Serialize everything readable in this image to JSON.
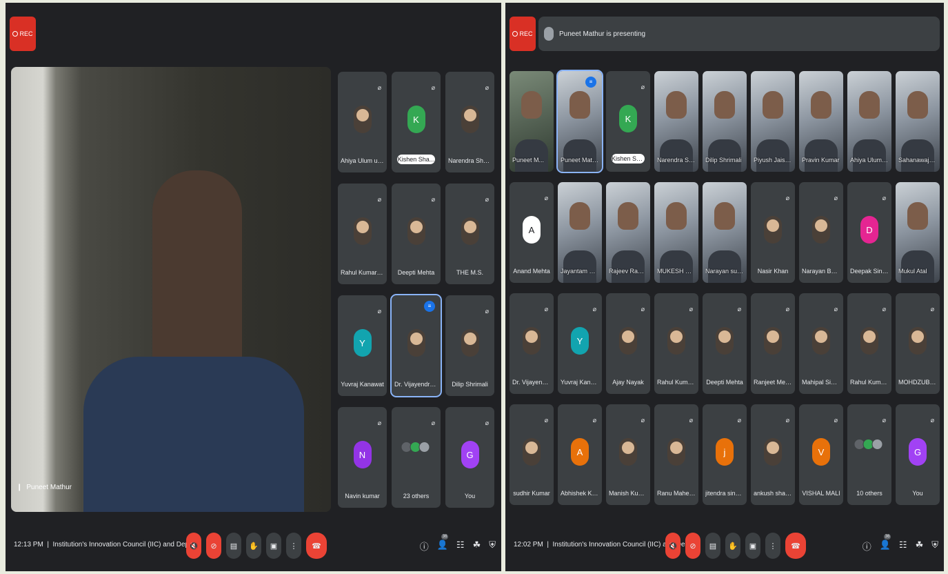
{
  "left": {
    "rec": "REC",
    "main_speaker": "Puneet Mathur",
    "tiles": [
      {
        "name": "Ahiya Ulum uddin",
        "type": "img"
      },
      {
        "name": "Kishen Sha...",
        "type": "letter",
        "letter": "K",
        "color": "#34a853",
        "pill": true
      },
      {
        "name": "Narendra Sharma",
        "type": "img"
      },
      {
        "name": "Rahul Kumar sen",
        "type": "img"
      },
      {
        "name": "Deepti Mehta",
        "type": "img"
      },
      {
        "name": "THE M.S.",
        "type": "img"
      },
      {
        "name": "Yuvraj Kanawat",
        "type": "letter",
        "letter": "Y",
        "color": "#12a4af"
      },
      {
        "name": "Dr. Vijayendra Si...",
        "type": "img",
        "speaking": true
      },
      {
        "name": "Dilip Shrimali",
        "type": "img"
      },
      {
        "name": "Navin kumar",
        "type": "letter",
        "letter": "N",
        "color": "#9334e6"
      },
      {
        "name": "23 others",
        "type": "others"
      },
      {
        "name": "You",
        "type": "letter",
        "letter": "G",
        "color": "#a142f4"
      }
    ],
    "time": "12:13 PM",
    "meeting": "Institution's Innovation Council (IIC) and Depa...",
    "people_count": "36"
  },
  "right": {
    "rec": "REC",
    "presenting": "Puneet Mathur is presenting",
    "tiles": [
      {
        "name": "Puneet M...",
        "type": "screen"
      },
      {
        "name": "Puneet Mathur",
        "type": "video",
        "speaking": true
      },
      {
        "name": "Kishen Sha...",
        "type": "letter",
        "letter": "K",
        "color": "#34a853",
        "pill": true
      },
      {
        "name": "Narendra Shar...",
        "type": "video"
      },
      {
        "name": "Dilip Shrimali",
        "type": "video"
      },
      {
        "name": "Piyush Jaiswal",
        "type": "video"
      },
      {
        "name": "Pravin Kumar",
        "type": "video"
      },
      {
        "name": "Ahiya Ulum ud...",
        "type": "video"
      },
      {
        "name": "Sahanawaj Hus...",
        "type": "video"
      },
      {
        "name": "Anand Mehta",
        "type": "letter",
        "letter": "A",
        "color": "#ffffff"
      },
      {
        "name": "Jayantam Saxe...",
        "type": "video"
      },
      {
        "name": "Rajeev Ranjan",
        "type": "video"
      },
      {
        "name": "MUKESH GAN...",
        "type": "video"
      },
      {
        "name": "Narayan suthar",
        "type": "video"
      },
      {
        "name": "Nasir Khan",
        "type": "img"
      },
      {
        "name": "Narayan Banjara",
        "type": "img"
      },
      {
        "name": "Deepak Singh",
        "type": "letter",
        "letter": "D",
        "color": "#e52592"
      },
      {
        "name": "Mukul Atal",
        "type": "video"
      },
      {
        "name": "Dr. Vijayendra Si...",
        "type": "img"
      },
      {
        "name": "Yuvraj Kanawat",
        "type": "letter",
        "letter": "Y",
        "color": "#12a4af"
      },
      {
        "name": "Ajay Nayak",
        "type": "img"
      },
      {
        "name": "Rahul Kumar sen",
        "type": "img"
      },
      {
        "name": "Deepti Mehta",
        "type": "img"
      },
      {
        "name": "Ranjeet Meena",
        "type": "img"
      },
      {
        "name": "Mahipal Singh K...",
        "type": "img"
      },
      {
        "name": "Rahul Kumar Me...",
        "type": "img"
      },
      {
        "name": "MOHDZUBER K...",
        "type": "img"
      },
      {
        "name": "sudhir Kumar",
        "type": "img"
      },
      {
        "name": "Abhishek Kumar",
        "type": "letter",
        "letter": "A",
        "color": "#e8710a"
      },
      {
        "name": "Manish Kumar",
        "type": "img"
      },
      {
        "name": "Ranu Maheshwari",
        "type": "img"
      },
      {
        "name": "jitendra singh c...",
        "type": "letter",
        "letter": "j",
        "color": "#e8710a"
      },
      {
        "name": "ankush sharma",
        "type": "img"
      },
      {
        "name": "VISHAL MALI",
        "type": "letter",
        "letter": "V",
        "color": "#e8710a"
      },
      {
        "name": "10 others",
        "type": "others"
      },
      {
        "name": "You",
        "type": "letter",
        "letter": "G",
        "color": "#a142f4"
      }
    ],
    "time": "12:02 PM",
    "meeting": "Institution's Innovation Council (IIC) and Dep...",
    "people_count": "36"
  }
}
